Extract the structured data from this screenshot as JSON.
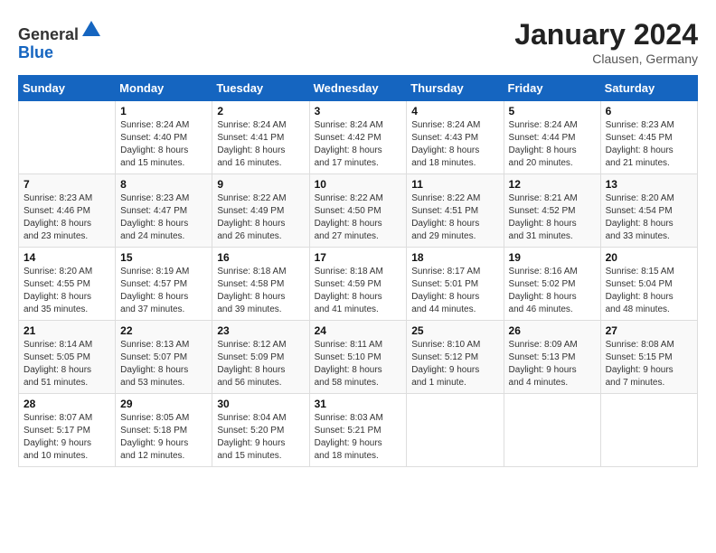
{
  "header": {
    "logo_line1": "General",
    "logo_line2": "Blue",
    "month_title": "January 2024",
    "location": "Clausen, Germany"
  },
  "weekdays": [
    "Sunday",
    "Monday",
    "Tuesday",
    "Wednesday",
    "Thursday",
    "Friday",
    "Saturday"
  ],
  "weeks": [
    [
      {
        "day": "",
        "sunrise": "",
        "sunset": "",
        "daylight": ""
      },
      {
        "day": "1",
        "sunrise": "Sunrise: 8:24 AM",
        "sunset": "Sunset: 4:40 PM",
        "daylight": "Daylight: 8 hours and 15 minutes."
      },
      {
        "day": "2",
        "sunrise": "Sunrise: 8:24 AM",
        "sunset": "Sunset: 4:41 PM",
        "daylight": "Daylight: 8 hours and 16 minutes."
      },
      {
        "day": "3",
        "sunrise": "Sunrise: 8:24 AM",
        "sunset": "Sunset: 4:42 PM",
        "daylight": "Daylight: 8 hours and 17 minutes."
      },
      {
        "day": "4",
        "sunrise": "Sunrise: 8:24 AM",
        "sunset": "Sunset: 4:43 PM",
        "daylight": "Daylight: 8 hours and 18 minutes."
      },
      {
        "day": "5",
        "sunrise": "Sunrise: 8:24 AM",
        "sunset": "Sunset: 4:44 PM",
        "daylight": "Daylight: 8 hours and 20 minutes."
      },
      {
        "day": "6",
        "sunrise": "Sunrise: 8:23 AM",
        "sunset": "Sunset: 4:45 PM",
        "daylight": "Daylight: 8 hours and 21 minutes."
      }
    ],
    [
      {
        "day": "7",
        "sunrise": "Sunrise: 8:23 AM",
        "sunset": "Sunset: 4:46 PM",
        "daylight": "Daylight: 8 hours and 23 minutes."
      },
      {
        "day": "8",
        "sunrise": "Sunrise: 8:23 AM",
        "sunset": "Sunset: 4:47 PM",
        "daylight": "Daylight: 8 hours and 24 minutes."
      },
      {
        "day": "9",
        "sunrise": "Sunrise: 8:22 AM",
        "sunset": "Sunset: 4:49 PM",
        "daylight": "Daylight: 8 hours and 26 minutes."
      },
      {
        "day": "10",
        "sunrise": "Sunrise: 8:22 AM",
        "sunset": "Sunset: 4:50 PM",
        "daylight": "Daylight: 8 hours and 27 minutes."
      },
      {
        "day": "11",
        "sunrise": "Sunrise: 8:22 AM",
        "sunset": "Sunset: 4:51 PM",
        "daylight": "Daylight: 8 hours and 29 minutes."
      },
      {
        "day": "12",
        "sunrise": "Sunrise: 8:21 AM",
        "sunset": "Sunset: 4:52 PM",
        "daylight": "Daylight: 8 hours and 31 minutes."
      },
      {
        "day": "13",
        "sunrise": "Sunrise: 8:20 AM",
        "sunset": "Sunset: 4:54 PM",
        "daylight": "Daylight: 8 hours and 33 minutes."
      }
    ],
    [
      {
        "day": "14",
        "sunrise": "Sunrise: 8:20 AM",
        "sunset": "Sunset: 4:55 PM",
        "daylight": "Daylight: 8 hours and 35 minutes."
      },
      {
        "day": "15",
        "sunrise": "Sunrise: 8:19 AM",
        "sunset": "Sunset: 4:57 PM",
        "daylight": "Daylight: 8 hours and 37 minutes."
      },
      {
        "day": "16",
        "sunrise": "Sunrise: 8:18 AM",
        "sunset": "Sunset: 4:58 PM",
        "daylight": "Daylight: 8 hours and 39 minutes."
      },
      {
        "day": "17",
        "sunrise": "Sunrise: 8:18 AM",
        "sunset": "Sunset: 4:59 PM",
        "daylight": "Daylight: 8 hours and 41 minutes."
      },
      {
        "day": "18",
        "sunrise": "Sunrise: 8:17 AM",
        "sunset": "Sunset: 5:01 PM",
        "daylight": "Daylight: 8 hours and 44 minutes."
      },
      {
        "day": "19",
        "sunrise": "Sunrise: 8:16 AM",
        "sunset": "Sunset: 5:02 PM",
        "daylight": "Daylight: 8 hours and 46 minutes."
      },
      {
        "day": "20",
        "sunrise": "Sunrise: 8:15 AM",
        "sunset": "Sunset: 5:04 PM",
        "daylight": "Daylight: 8 hours and 48 minutes."
      }
    ],
    [
      {
        "day": "21",
        "sunrise": "Sunrise: 8:14 AM",
        "sunset": "Sunset: 5:05 PM",
        "daylight": "Daylight: 8 hours and 51 minutes."
      },
      {
        "day": "22",
        "sunrise": "Sunrise: 8:13 AM",
        "sunset": "Sunset: 5:07 PM",
        "daylight": "Daylight: 8 hours and 53 minutes."
      },
      {
        "day": "23",
        "sunrise": "Sunrise: 8:12 AM",
        "sunset": "Sunset: 5:09 PM",
        "daylight": "Daylight: 8 hours and 56 minutes."
      },
      {
        "day": "24",
        "sunrise": "Sunrise: 8:11 AM",
        "sunset": "Sunset: 5:10 PM",
        "daylight": "Daylight: 8 hours and 58 minutes."
      },
      {
        "day": "25",
        "sunrise": "Sunrise: 8:10 AM",
        "sunset": "Sunset: 5:12 PM",
        "daylight": "Daylight: 9 hours and 1 minute."
      },
      {
        "day": "26",
        "sunrise": "Sunrise: 8:09 AM",
        "sunset": "Sunset: 5:13 PM",
        "daylight": "Daylight: 9 hours and 4 minutes."
      },
      {
        "day": "27",
        "sunrise": "Sunrise: 8:08 AM",
        "sunset": "Sunset: 5:15 PM",
        "daylight": "Daylight: 9 hours and 7 minutes."
      }
    ],
    [
      {
        "day": "28",
        "sunrise": "Sunrise: 8:07 AM",
        "sunset": "Sunset: 5:17 PM",
        "daylight": "Daylight: 9 hours and 10 minutes."
      },
      {
        "day": "29",
        "sunrise": "Sunrise: 8:05 AM",
        "sunset": "Sunset: 5:18 PM",
        "daylight": "Daylight: 9 hours and 12 minutes."
      },
      {
        "day": "30",
        "sunrise": "Sunrise: 8:04 AM",
        "sunset": "Sunset: 5:20 PM",
        "daylight": "Daylight: 9 hours and 15 minutes."
      },
      {
        "day": "31",
        "sunrise": "Sunrise: 8:03 AM",
        "sunset": "Sunset: 5:21 PM",
        "daylight": "Daylight: 9 hours and 18 minutes."
      },
      {
        "day": "",
        "sunrise": "",
        "sunset": "",
        "daylight": ""
      },
      {
        "day": "",
        "sunrise": "",
        "sunset": "",
        "daylight": ""
      },
      {
        "day": "",
        "sunrise": "",
        "sunset": "",
        "daylight": ""
      }
    ]
  ]
}
